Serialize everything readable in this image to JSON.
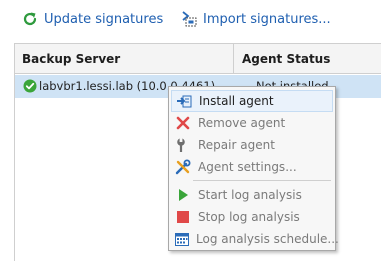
{
  "toolbar": {
    "update_label": "Update signatures",
    "import_label": "Import signatures..."
  },
  "table": {
    "columns": [
      "Backup Server",
      "Agent Status"
    ],
    "rows": [
      {
        "server": "labvbr1.lessi.lab (10.0.0.4461)",
        "status": "Not installed"
      }
    ]
  },
  "context_menu": {
    "items": [
      {
        "label": "Install agent",
        "icon": "install-agent-icon",
        "enabled": true
      },
      {
        "label": "Remove agent",
        "icon": "remove-x-icon",
        "enabled": false
      },
      {
        "label": "Repair agent",
        "icon": "wrench-icon",
        "enabled": false
      },
      {
        "label": "Agent settings...",
        "icon": "tools-icon",
        "enabled": false
      },
      {
        "label": "Start log analysis",
        "icon": "play-icon",
        "enabled": false
      },
      {
        "label": "Stop log analysis",
        "icon": "stop-icon",
        "enabled": false
      },
      {
        "label": "Log analysis schedule...",
        "icon": "calendar-icon",
        "enabled": false
      }
    ]
  },
  "colors": {
    "link": "#1f5fb0",
    "selection": "#cfe3f5",
    "success": "#3aa53a",
    "danger": "#e04848"
  }
}
